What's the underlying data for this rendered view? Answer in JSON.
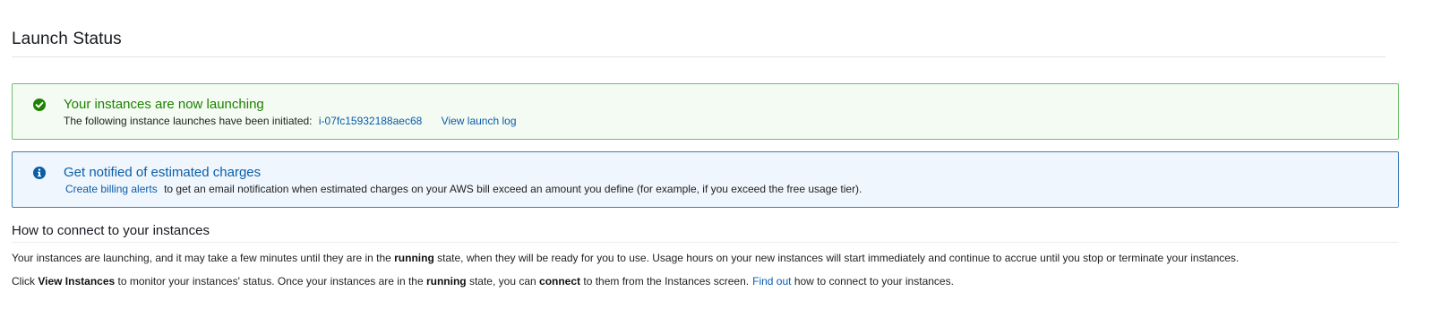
{
  "page": {
    "title": "Launch Status"
  },
  "success_alert": {
    "icon": "check-circle-icon",
    "color": "#1d8102",
    "heading": "Your instances are now launching",
    "body_text": "The following instance launches have been initiated:",
    "instance_id": "i-07fc15932188aec68",
    "log_link": "View launch log"
  },
  "info_alert": {
    "icon": "info-circle-icon",
    "color": "#0b5ea8",
    "heading": "Get notified of estimated charges",
    "link": "Create billing alerts",
    "body_text": "to get an email notification when estimated charges on your AWS bill exceed an amount you define (for example, if you exceed the free usage tier)."
  },
  "connect_section": {
    "heading": "How to connect to your instances",
    "paragraph1": {
      "before": "Your instances are launching, and it may take a few minutes until they are in the ",
      "bold": "running",
      "after": " state, when they will be ready for you to use. Usage hours on your new instances will start immediately and continue to accrue until you stop or terminate your instances."
    },
    "paragraph2": {
      "part1": "Click ",
      "bold1": "View Instances",
      "part2": " to monitor your instances' status. Once your instances are in the ",
      "bold2": "running",
      "part3": " state, you can ",
      "bold3": "connect",
      "part4": " to them from the Instances screen.",
      "link": "Find out",
      "part5": " how to connect to your instances."
    }
  }
}
